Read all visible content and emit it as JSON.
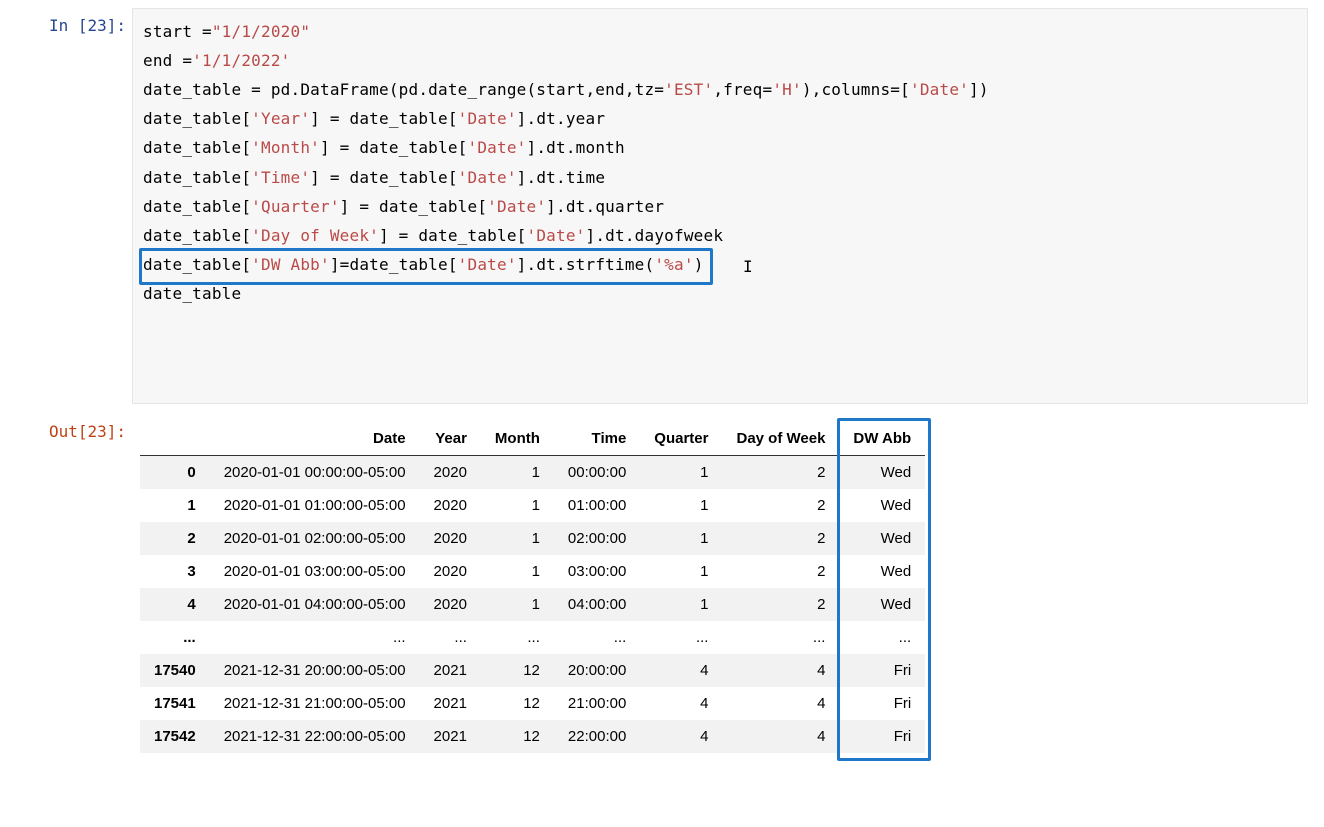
{
  "input_prompt": "In [23]:",
  "output_prompt": "Out[23]:",
  "code": {
    "l1_a": "start =",
    "l1_s": "\"1/1/2020\"",
    "l2_a": "end =",
    "l2_s": "'1/1/2022'",
    "l3_a": "date_table = pd.DataFrame(pd.date_range(start,end,tz=",
    "l3_s1": "'EST'",
    "l3_b": ",freq=",
    "l3_s2": "'H'",
    "l3_c": "),columns=[",
    "l3_s3": "'Date'",
    "l3_d": "])",
    "l4_a": "date_table[",
    "l4_s1": "'Year'",
    "l4_b": "] = date_table[",
    "l4_s2": "'Date'",
    "l4_c": "].dt.year",
    "l5_a": "date_table[",
    "l5_s1": "'Month'",
    "l5_b": "] = date_table[",
    "l5_s2": "'Date'",
    "l5_c": "].dt.month",
    "l6_a": "date_table[",
    "l6_s1": "'Time'",
    "l6_b": "] = date_table[",
    "l6_s2": "'Date'",
    "l6_c": "].dt.time",
    "l7_a": "date_table[",
    "l7_s1": "'Quarter'",
    "l7_b": "] = date_table[",
    "l7_s2": "'Date'",
    "l7_c": "].dt.quarter",
    "l8_a": "date_table[",
    "l8_s1": "'Day of Week'",
    "l8_b": "] = date_table[",
    "l8_s2": "'Date'",
    "l8_c": "].dt.dayofweek",
    "l9_a": "date_table[",
    "l9_s1": "'DW Abb'",
    "l9_b": "]=date_table[",
    "l9_s2": "'Date'",
    "l9_c": "].dt.strftime(",
    "l9_s3": "'%a'",
    "l9_d": ")",
    "l10": "date_table"
  },
  "table": {
    "headers": [
      "",
      "Date",
      "Year",
      "Month",
      "Time",
      "Quarter",
      "Day of Week",
      "DW Abb"
    ],
    "rows": [
      {
        "idx": "0",
        "date": "2020-01-01 00:00:00-05:00",
        "year": "2020",
        "month": "1",
        "time": "00:00:00",
        "quarter": "1",
        "dow": "2",
        "dwabb": "Wed"
      },
      {
        "idx": "1",
        "date": "2020-01-01 01:00:00-05:00",
        "year": "2020",
        "month": "1",
        "time": "01:00:00",
        "quarter": "1",
        "dow": "2",
        "dwabb": "Wed"
      },
      {
        "idx": "2",
        "date": "2020-01-01 02:00:00-05:00",
        "year": "2020",
        "month": "1",
        "time": "02:00:00",
        "quarter": "1",
        "dow": "2",
        "dwabb": "Wed"
      },
      {
        "idx": "3",
        "date": "2020-01-01 03:00:00-05:00",
        "year": "2020",
        "month": "1",
        "time": "03:00:00",
        "quarter": "1",
        "dow": "2",
        "dwabb": "Wed"
      },
      {
        "idx": "4",
        "date": "2020-01-01 04:00:00-05:00",
        "year": "2020",
        "month": "1",
        "time": "04:00:00",
        "quarter": "1",
        "dow": "2",
        "dwabb": "Wed"
      },
      {
        "idx": "...",
        "date": "...",
        "year": "...",
        "month": "...",
        "time": "...",
        "quarter": "...",
        "dow": "...",
        "dwabb": "..."
      },
      {
        "idx": "17540",
        "date": "2021-12-31 20:00:00-05:00",
        "year": "2021",
        "month": "12",
        "time": "20:00:00",
        "quarter": "4",
        "dow": "4",
        "dwabb": "Fri"
      },
      {
        "idx": "17541",
        "date": "2021-12-31 21:00:00-05:00",
        "year": "2021",
        "month": "12",
        "time": "21:00:00",
        "quarter": "4",
        "dow": "4",
        "dwabb": "Fri"
      },
      {
        "idx": "17542",
        "date": "2021-12-31 22:00:00-05:00",
        "year": "2021",
        "month": "12",
        "time": "22:00:00",
        "quarter": "4",
        "dow": "4",
        "dwabb": "Fri"
      }
    ]
  }
}
